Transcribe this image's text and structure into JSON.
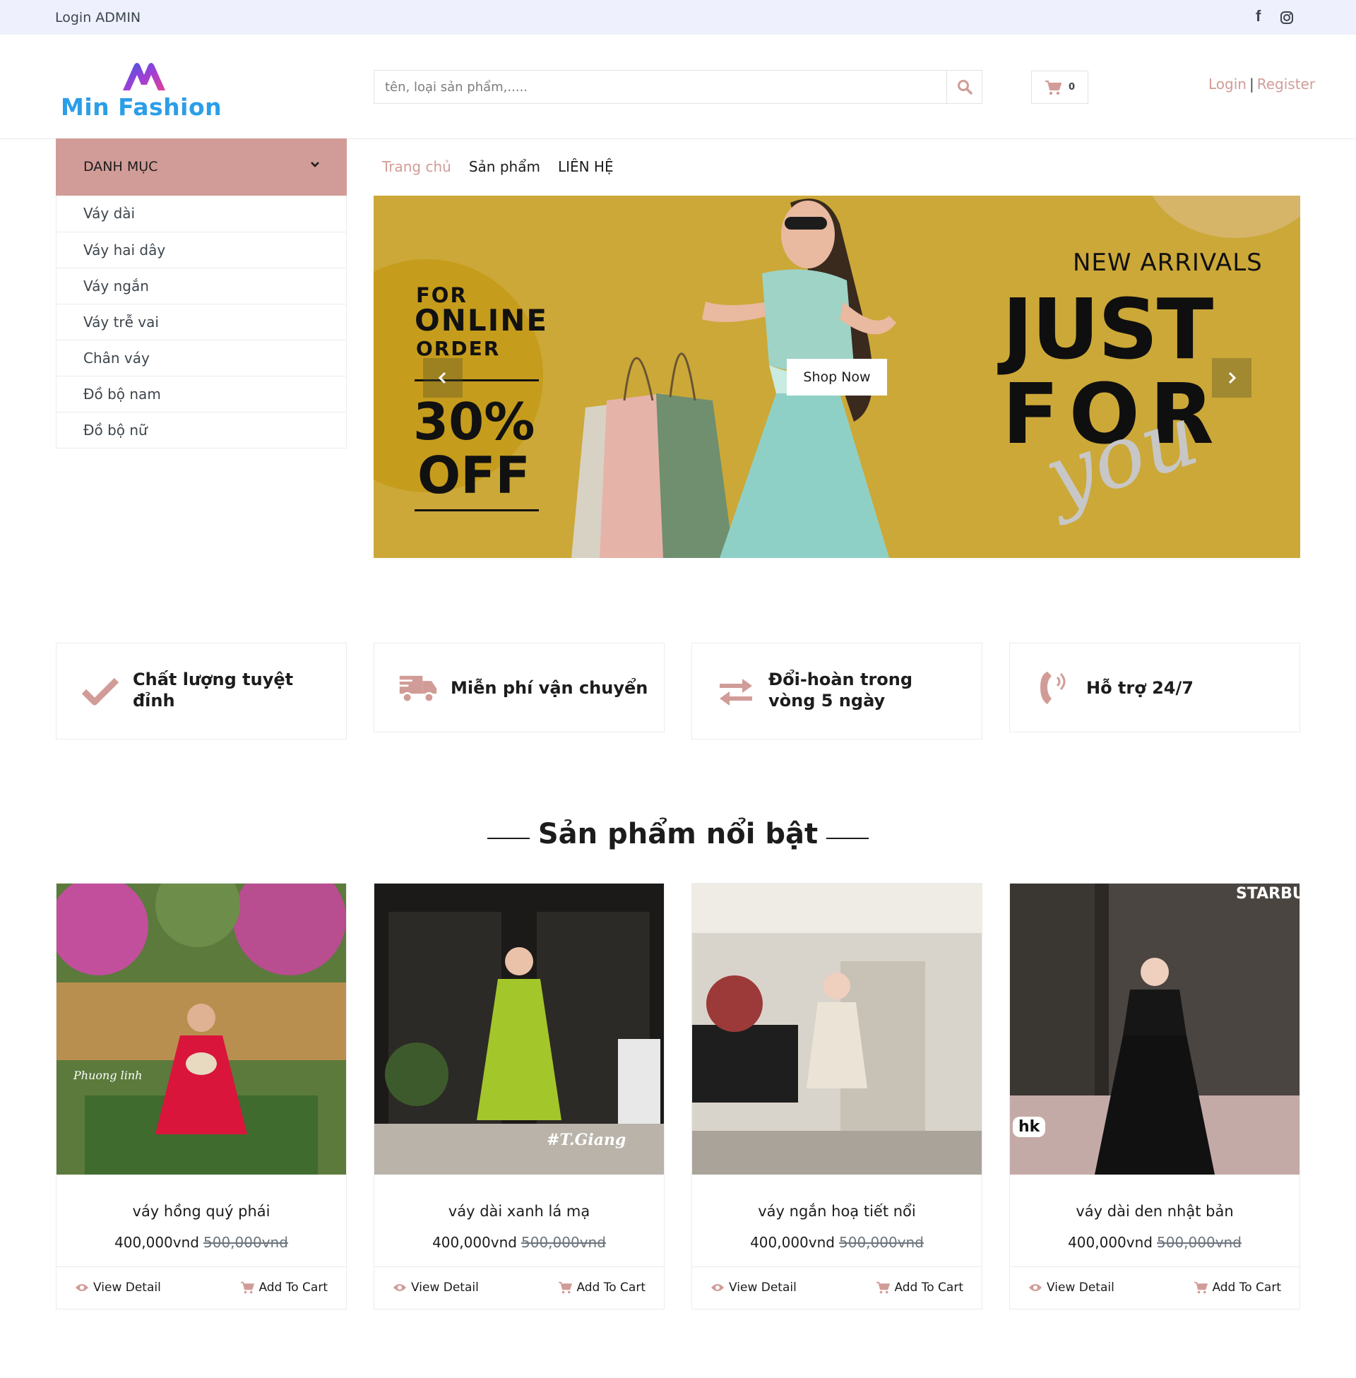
{
  "topbar": {
    "admin_link": "Login ADMIN",
    "social": [
      "facebook-icon",
      "instagram-icon"
    ]
  },
  "header": {
    "logo_text": "Min Fashion",
    "search": {
      "placeholder": "tên, loại sản phẩm,....."
    },
    "cart": {
      "count": "0"
    },
    "auth": {
      "login": "Login",
      "separator": "|",
      "register": "Register"
    }
  },
  "sidebar": {
    "title": "DANH MỤC",
    "items": [
      {
        "label": "Váy dài"
      },
      {
        "label": "Váy hai dây"
      },
      {
        "label": "Váy ngắn"
      },
      {
        "label": "Váy trễ vai"
      },
      {
        "label": "Chân váy"
      },
      {
        "label": "Đồ bộ nam"
      },
      {
        "label": "Đồ bộ nữ"
      }
    ]
  },
  "nav": {
    "items": [
      {
        "label": "Trang chủ",
        "active": true
      },
      {
        "label": "Sản phẩm",
        "active": false
      },
      {
        "label": "LIÊN HỆ",
        "active": false
      }
    ]
  },
  "banner": {
    "promo_for": "FOR",
    "promo_online": "ONLINE",
    "promo_order": "ORDER",
    "promo_percent": "30%",
    "promo_off": "OFF",
    "new_arrivals": "NEW ARRIVALS",
    "headline_1": "JUST",
    "headline_2": "FOR",
    "script_word": "you",
    "button": "Shop Now"
  },
  "features": [
    {
      "icon": "check-icon",
      "text_1": "Chất lượng tuyệt",
      "text_2": "đỉnh"
    },
    {
      "icon": "truck-icon",
      "text_1": "Miễn phí vận chuyển",
      "text_2": ""
    },
    {
      "icon": "exchange-icon",
      "text_1": "Đổi-hoàn trong",
      "text_2": "vòng 5 ngày"
    },
    {
      "icon": "phone-icon",
      "text_1": "Hỗ trợ 24/7",
      "text_2": ""
    }
  ],
  "section_title": "Sản phẩm nổi bật",
  "products": [
    {
      "name": "váy hồng quý phái",
      "price": "400,000vnd",
      "old_price": "500,000vnd",
      "view": "View Detail",
      "add": "Add To Cart",
      "photo_caption": "Phuong linh"
    },
    {
      "name": "váy dài xanh lá mạ",
      "price": "400,000vnd",
      "old_price": "500,000vnd",
      "view": "View Detail",
      "add": "Add To Cart",
      "photo_caption": "#T.Giang"
    },
    {
      "name": "váy ngắn hoạ tiết nổi",
      "price": "400,000vnd",
      "old_price": "500,000vnd",
      "view": "View Detail",
      "add": "Add To Cart",
      "photo_caption": ""
    },
    {
      "name": "váy dài den nhật bản",
      "price": "400,000vnd",
      "old_price": "500,000vnd",
      "view": "View Detail",
      "add": "Add To Cart",
      "photo_caption": "hk",
      "photo_sign": "STARBU"
    }
  ],
  "colors": {
    "accent": "#d19c97",
    "topbar_bg": "#eef0fd",
    "banner_bg": "#cca838",
    "logo": "#2b9ee8"
  }
}
